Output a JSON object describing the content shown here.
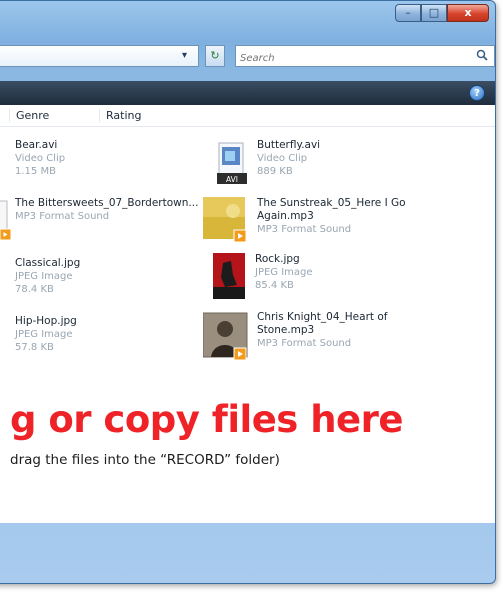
{
  "window": {
    "controls": {
      "minimize": "–",
      "maximize": "□",
      "close": "x"
    }
  },
  "toolbar": {
    "address_dropdown": "▾",
    "refresh": "↻",
    "search_placeholder": "Search",
    "search_icon": "magnifier-icon"
  },
  "commandbar": {
    "help": "?"
  },
  "columns": {
    "genre": "Genre",
    "rating": "Rating"
  },
  "files": [
    {
      "name": "Bear.avi",
      "type": "Video Clip",
      "size": "1.15 MB",
      "icon": "video-file-icon"
    },
    {
      "name": "Butterfly.avi",
      "type": "Video Clip",
      "size": "889 KB",
      "icon": "video-file-icon",
      "badge": "AVI"
    },
    {
      "name": "The Bittersweets_07_Bordertown...",
      "type": "MP3 Format Sound",
      "size": "",
      "icon": "audio-file-icon"
    },
    {
      "name": "The Sunstreak_05_Here I Go Again.mp3",
      "type": "MP3 Format Sound",
      "size": "",
      "icon": "album-art-icon"
    },
    {
      "name": "Classical.jpg",
      "type": "JPEG Image",
      "size": "78.4 KB",
      "icon": "image-file-icon"
    },
    {
      "name": "Rock.jpg",
      "type": "JPEG Image",
      "size": "85.4 KB",
      "icon": "image-file-icon"
    },
    {
      "name": "Hip-Hop.jpg",
      "type": "JPEG Image",
      "size": "57.8 KB",
      "icon": "image-file-icon"
    },
    {
      "name": "Chris Knight_04_Heart of Stone.mp3",
      "type": "MP3 Format Sound",
      "size": "",
      "icon": "album-art-icon"
    }
  ],
  "overlay": {
    "title": "g or copy files here",
    "subtitle": "drag the files into the “RECORD” folder)"
  },
  "colors": {
    "accent_red": "#ee2227",
    "window_blue": "#7fb0df",
    "command_bar": "#1f2c3c"
  }
}
